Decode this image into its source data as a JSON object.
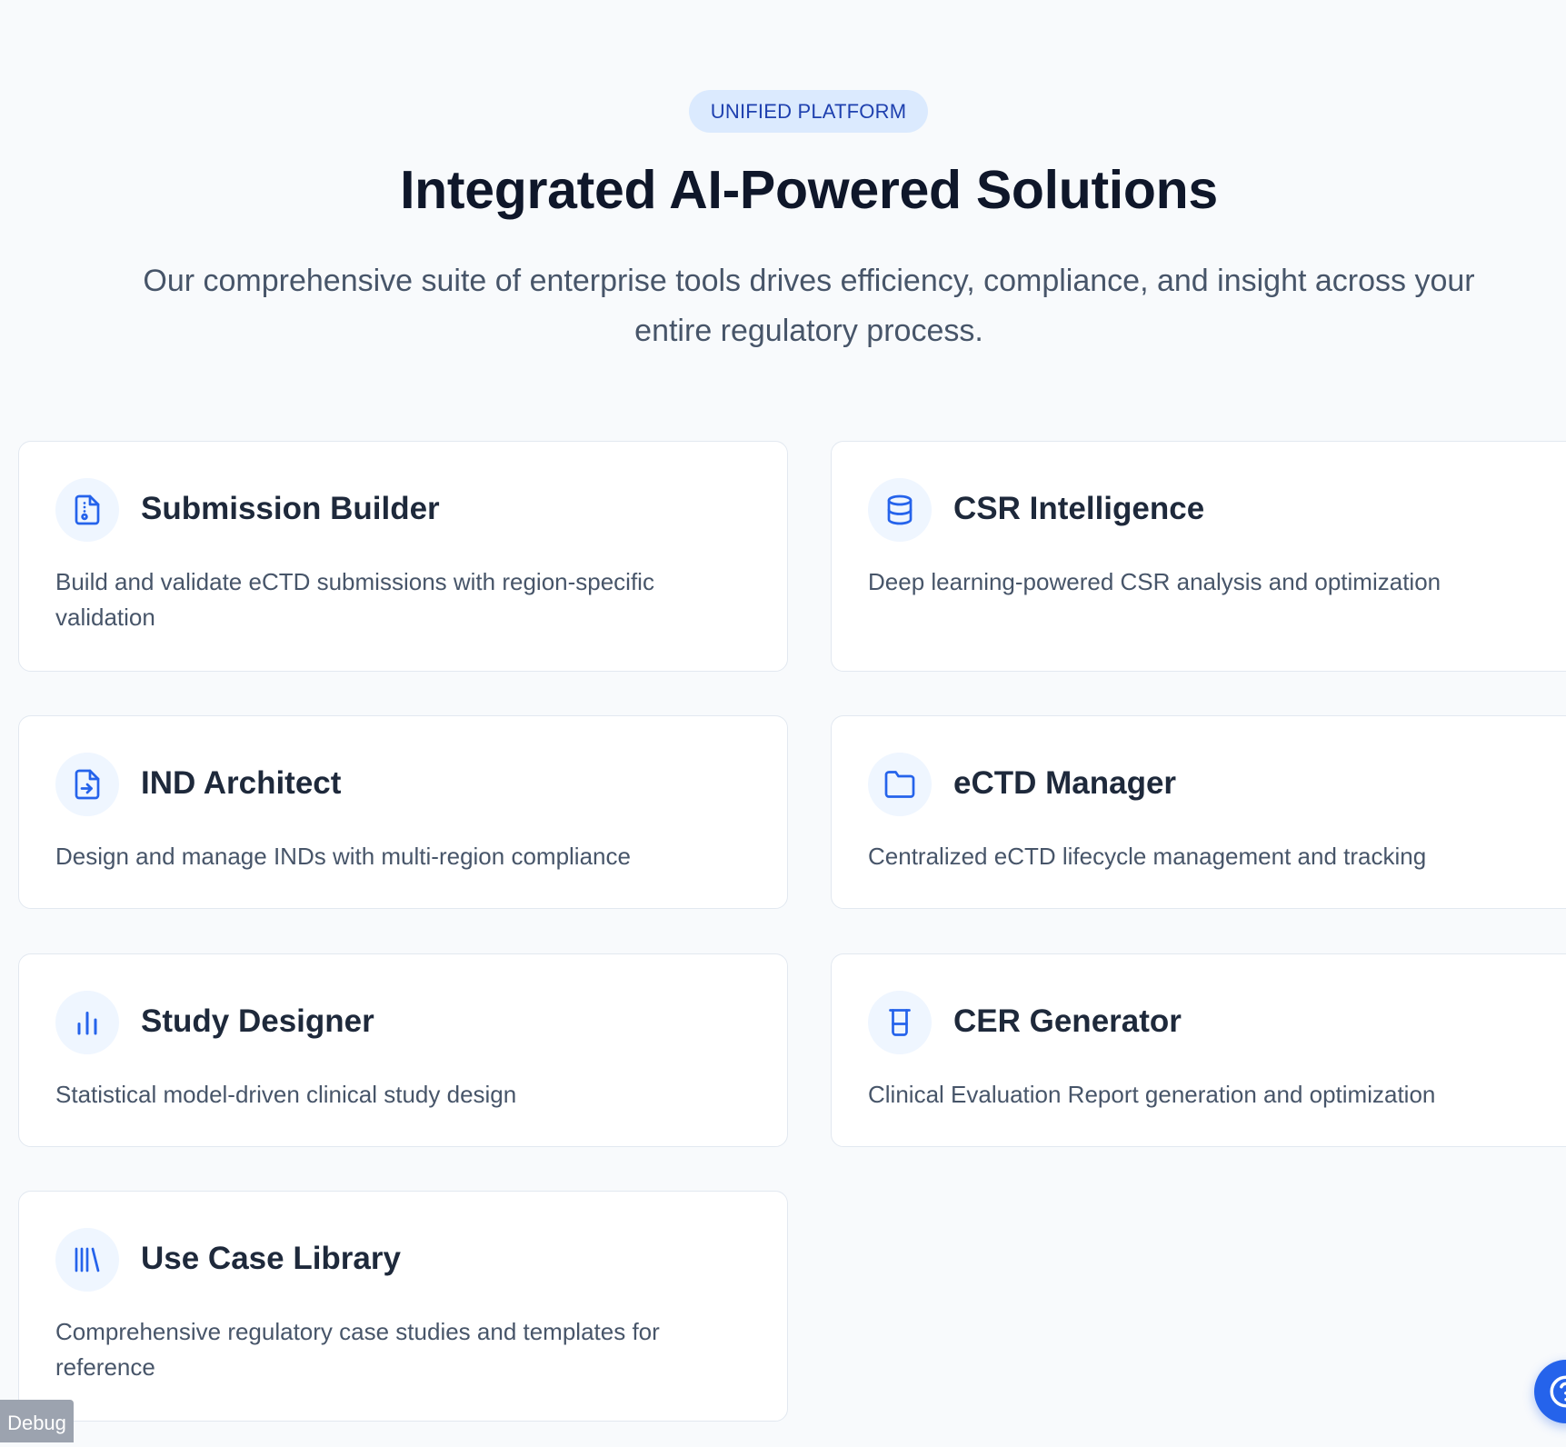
{
  "header": {
    "badge": "UNIFIED PLATFORM",
    "title": "Integrated AI-Powered Solutions",
    "subtitle": "Our comprehensive suite of enterprise tools drives efficiency, compliance, and insight across your entire regulatory process."
  },
  "cards": [
    {
      "icon": "file-check-icon",
      "title": "Submission Builder",
      "description": "Build and validate eCTD submissions with region-specific validation"
    },
    {
      "icon": "database-icon",
      "title": "CSR Intelligence",
      "description": "Deep learning-powered CSR analysis and optimization"
    },
    {
      "icon": "file-input-icon",
      "title": "IND Architect",
      "description": "Design and manage INDs with multi-region compliance"
    },
    {
      "icon": "folder-icon",
      "title": "eCTD Manager",
      "description": "Centralized eCTD lifecycle management and tracking"
    },
    {
      "icon": "bar-chart-icon",
      "title": "Study Designer",
      "description": "Statistical model-driven clinical study design"
    },
    {
      "icon": "beaker-icon",
      "title": "CER Generator",
      "description": "Clinical Evaluation Report generation and optimization"
    },
    {
      "icon": "library-icon",
      "title": "Use Case Library",
      "description": "Comprehensive regulatory case studies and templates for reference"
    }
  ],
  "debug": {
    "label": "Debug"
  },
  "help_button": {
    "icon": "help-icon"
  },
  "colors": {
    "accent": "#2563eb",
    "badge_bg": "#dbeafe",
    "badge_text": "#1e40af",
    "page_bg": "#f8fafc"
  }
}
